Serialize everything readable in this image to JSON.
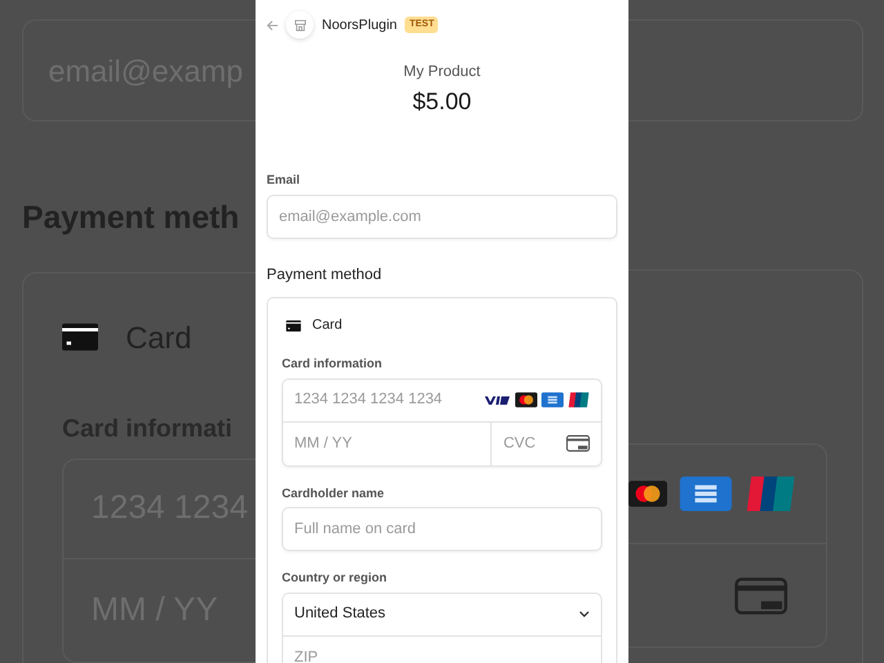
{
  "backdrop": {
    "email_text": "email@examp",
    "payment_title": "Payment meth",
    "method": "Card",
    "card_info_label": "Card informati",
    "number_text": "1234 1234",
    "expiry_text": "MM / YY"
  },
  "header": {
    "merchant": "NoorsPlugin",
    "badge": "TEST"
  },
  "product": {
    "name": "My Product",
    "price": "$5.00"
  },
  "email": {
    "label": "Email",
    "placeholder": "email@example.com"
  },
  "payment": {
    "title": "Payment method",
    "method": "Card",
    "card_info_label": "Card information",
    "number_placeholder": "1234 1234 1234 1234",
    "expiry_placeholder": "MM / YY",
    "cvc_placeholder": "CVC",
    "cardholder_label": "Cardholder name",
    "cardholder_placeholder": "Full name on card",
    "country_label": "Country or region",
    "country_value": "United States",
    "zip_placeholder": "ZIP"
  }
}
